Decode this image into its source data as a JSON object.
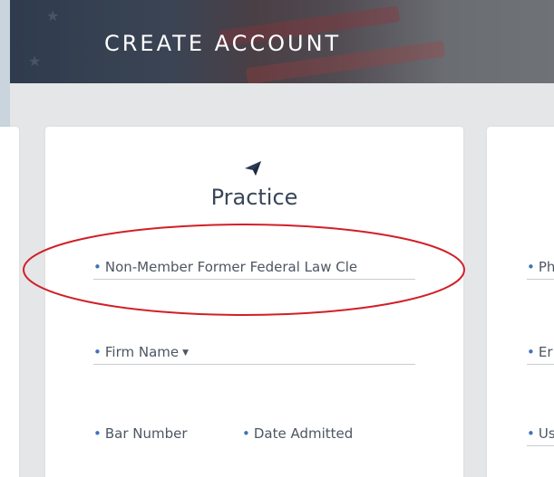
{
  "header": {
    "title": "CREATE ACCOUNT"
  },
  "practice_card": {
    "title": "Practice",
    "icon": "paper-plane-icon",
    "fields": {
      "clerk_type": "Non-Member Former Federal Law Cle",
      "firm_name": "Firm Name",
      "bar_number": "Bar Number",
      "date_admitted": "Date Admitted"
    }
  },
  "right_card": {
    "fields": {
      "field1": "Ph",
      "field2": "Er",
      "field3": "Us"
    }
  },
  "colors": {
    "accent_dot": "#3d73b8",
    "annotation_red": "#d21f26",
    "title_text": "#3a4658"
  }
}
